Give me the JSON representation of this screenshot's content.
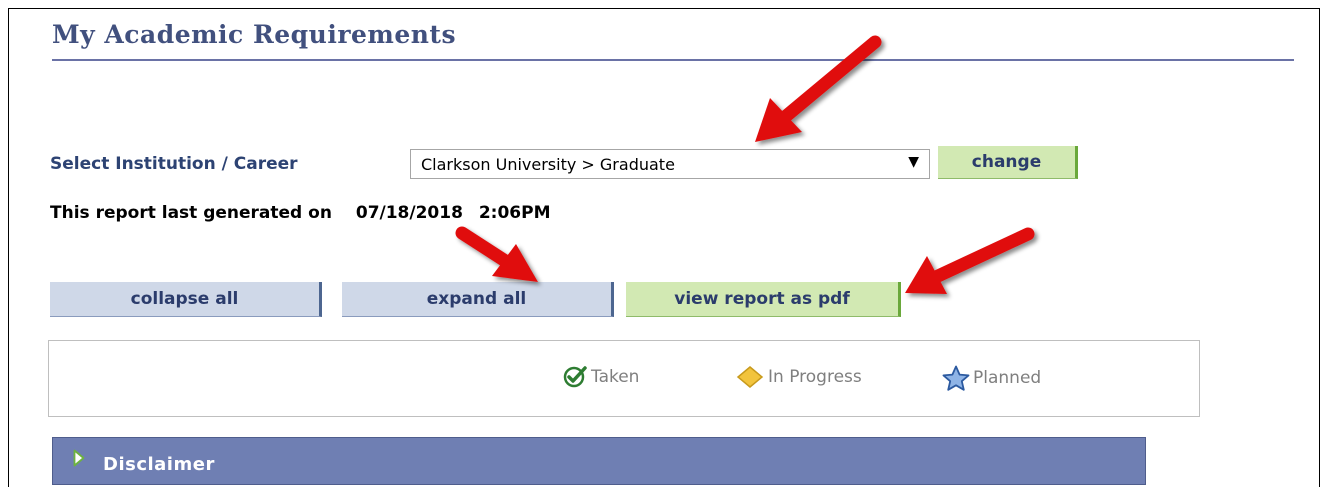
{
  "page": {
    "title": "My Academic Requirements"
  },
  "selector": {
    "label": "Select Institution / Career",
    "value": "Clarkson University > Graduate",
    "caret": "▼",
    "change_label": "change"
  },
  "report": {
    "label": "This report last generated on",
    "date": "07/18/2018",
    "time": "2:06PM"
  },
  "buttons": {
    "collapse_label": "collapse all",
    "expand_label": "expand all",
    "pdf_label": "view report as pdf"
  },
  "legend": {
    "taken": "Taken",
    "in_progress": "In Progress",
    "planned": "Planned"
  },
  "section": {
    "disclaimer_label": "Disclaimer"
  },
  "colors": {
    "title": "#41507e",
    "green_button": "#d2e9b3",
    "blue_button": "#cfd8e8",
    "section_bar": "#6f7fb3",
    "annotation_arrow": "#e01010"
  },
  "annotations": {
    "arrows": [
      "arrow-to-career-select",
      "arrow-to-expand-all",
      "arrow-to-view-pdf"
    ]
  }
}
